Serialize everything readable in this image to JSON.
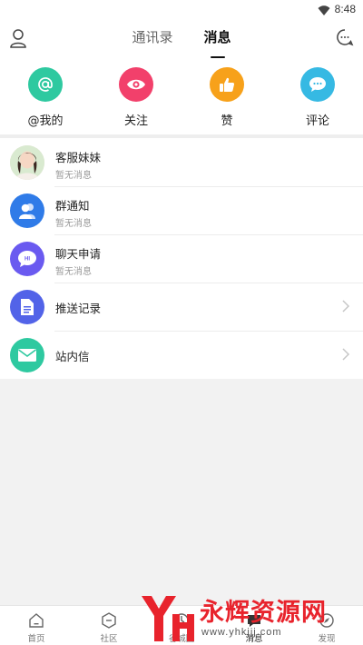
{
  "status": {
    "time": "8:48"
  },
  "header": {
    "tabs": [
      {
        "label": "通讯录",
        "active": false
      },
      {
        "label": "消息",
        "active": true
      }
    ]
  },
  "quick_actions": [
    {
      "label": "@我的",
      "icon": "at-icon",
      "color": "#2ec9a0"
    },
    {
      "label": "关注",
      "icon": "eye-icon",
      "color": "#f2406b"
    },
    {
      "label": "赞",
      "icon": "thumbs-up-icon",
      "color": "#f7a11a"
    },
    {
      "label": "评论",
      "icon": "comment-icon",
      "color": "#36b9e3"
    }
  ],
  "messages": [
    {
      "title": "客服妹妹",
      "subtitle": "暂无消息",
      "icon": "support-avatar"
    },
    {
      "title": "群通知",
      "subtitle": "暂无消息",
      "icon": "group-icon",
      "color": "#2f7be8"
    },
    {
      "title": "聊天申请",
      "subtitle": "暂无消息",
      "icon": "chat-request-icon",
      "color": "#6a5af0"
    }
  ],
  "links": [
    {
      "title": "推送记录",
      "icon": "document-icon",
      "color": "#5263e8"
    },
    {
      "title": "站内信",
      "icon": "mail-icon",
      "color": "#2ec9a0"
    }
  ],
  "bottom_nav": [
    {
      "label": "首页",
      "icon": "home-icon"
    },
    {
      "label": "社区",
      "icon": "community-icon"
    },
    {
      "label": "谷城圈",
      "icon": "circle-icon"
    },
    {
      "label": "消息",
      "icon": "message-icon",
      "active": true
    },
    {
      "label": "发现",
      "icon": "discover-icon"
    }
  ],
  "watermark": {
    "text": "永辉资源网",
    "url": "www.yhkjjj.com"
  }
}
